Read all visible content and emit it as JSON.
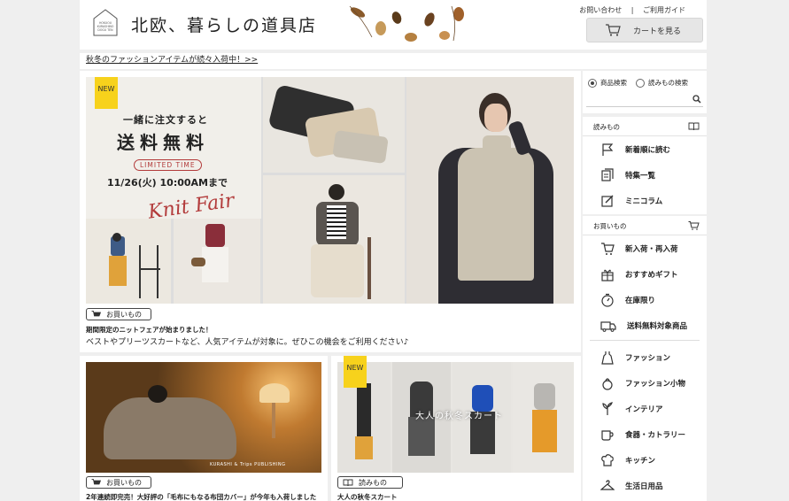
{
  "header": {
    "site_title": "北欧、暮らしの道具店",
    "logo_small": "HOKUOU KURASHINO DOGU TEN",
    "contact": "お問い合わせ",
    "separator": "|",
    "guide": "ご利用ガイド",
    "cart": "カートを見る"
  },
  "announcement": "秋冬のファッションアイテムが続々入荷中！>>",
  "hero": {
    "new_badge": "NEW",
    "headline_1": "一緒に注文すると",
    "headline_2": "送料無料",
    "limited": "LIMITED TIME",
    "deadline": "11/26(火) 10:00AMまで",
    "script": "Knit Fair",
    "category": "お買いもの",
    "title": "期間限定のニットフェアが始まりました！",
    "desc": "ベストやプリーツスカートなど、人気アイテムが対象に。ぜひこの機会をご利用ください♪"
  },
  "cards": [
    {
      "category": "お買いもの",
      "title": "2年連続即完売！大好評の「毛布にもなる布団カバー」が今年も入荷しました",
      "credit": "KURASHI & Trips PUBLISHING"
    },
    {
      "new_badge": "NEW",
      "overlay": "大人の秋冬スカート",
      "category": "読みもの",
      "title": "大人の秋冬スカート"
    }
  ],
  "sidebar": {
    "search_options": [
      "商品検索",
      "読みもの検索"
    ],
    "search_placeholder": "",
    "reading": {
      "title": "読みもの",
      "items": [
        "新着順に読む",
        "特集一覧",
        "ミニコラム"
      ]
    },
    "shopping": {
      "title": "お買いもの",
      "items": [
        "新入荷・再入荷",
        "おすすめギフト",
        "在庫限り",
        "送料無料対象商品"
      ],
      "categories": [
        "ファッション",
        "ファッション小物",
        "インテリア",
        "食器・カトラリー",
        "キッチン",
        "生活日用品"
      ]
    }
  },
  "colors": {
    "new_badge": "#f7d21c",
    "accent_red": "#b23a3a"
  }
}
